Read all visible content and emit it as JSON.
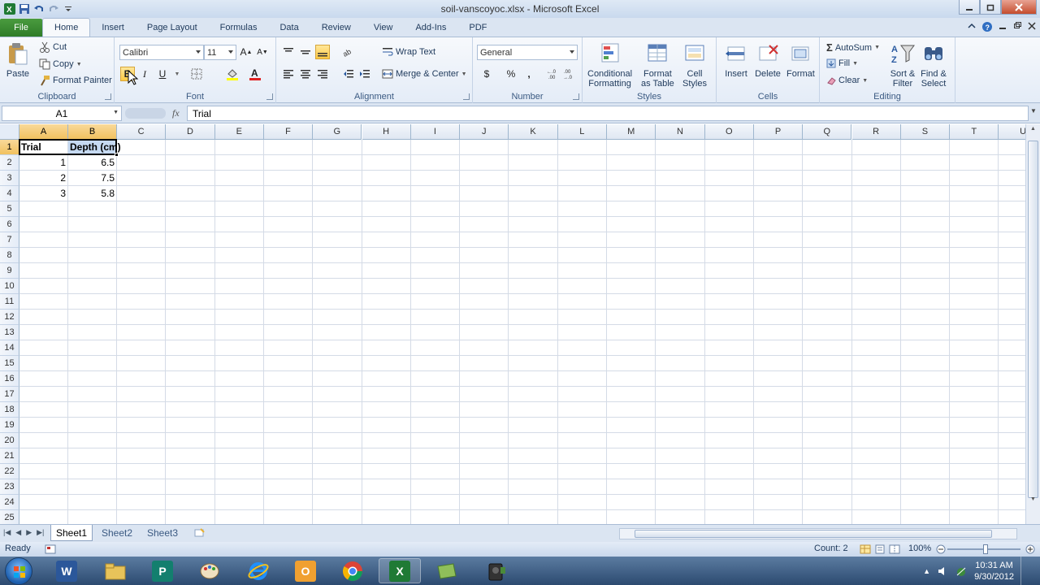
{
  "window": {
    "title": "soil-vanscoyoc.xlsx - Microsoft Excel"
  },
  "ribbon_tabs": {
    "file": "File",
    "tabs": [
      "Home",
      "Insert",
      "Page Layout",
      "Formulas",
      "Data",
      "Review",
      "View",
      "Add-Ins",
      "PDF"
    ],
    "active": "Home"
  },
  "clipboard": {
    "paste": "Paste",
    "cut": "Cut",
    "copy": "Copy",
    "format_painter": "Format Painter",
    "label": "Clipboard"
  },
  "font": {
    "name": "Calibri",
    "size": "11",
    "bold": "B",
    "italic": "I",
    "underline": "U",
    "label": "Font",
    "font_color": "#e02020",
    "fill_color": "#ffff00"
  },
  "alignment": {
    "wrap_text": "Wrap Text",
    "merge_center": "Merge & Center",
    "label": "Alignment"
  },
  "number": {
    "format": "General",
    "currency": "$",
    "percent": "%",
    "comma": ",",
    "label": "Number"
  },
  "styles": {
    "conditional": [
      "Conditional",
      "Formatting"
    ],
    "format_table": [
      "Format",
      "as Table"
    ],
    "cell_styles": [
      "Cell",
      "Styles"
    ],
    "label": "Styles"
  },
  "cells": {
    "insert": "Insert",
    "delete": "Delete",
    "format": "Format",
    "label": "Cells"
  },
  "editing": {
    "autosum": "AutoSum",
    "fill": "Fill",
    "clear": "Clear",
    "sort_filter": [
      "Sort &",
      "Filter"
    ],
    "find_select": [
      "Find &",
      "Select"
    ],
    "label": "Editing"
  },
  "formula_bar": {
    "name_box": "A1",
    "fx": "fx",
    "content": "Trial"
  },
  "grid": {
    "columns": [
      "A",
      "B",
      "C",
      "D",
      "E",
      "F",
      "G",
      "H",
      "I",
      "J",
      "K",
      "L",
      "M",
      "N",
      "O",
      "P",
      "Q",
      "R",
      "S",
      "T",
      "U"
    ],
    "rows": [
      "1",
      "2",
      "3",
      "4",
      "5",
      "6",
      "7",
      "8",
      "9",
      "10",
      "11",
      "12",
      "13",
      "14",
      "15",
      "16",
      "17",
      "18",
      "19",
      "20",
      "21",
      "22",
      "23",
      "24",
      "25"
    ],
    "data": [
      [
        "Trial",
        "Depth (cm)"
      ],
      [
        "1",
        "6.5"
      ],
      [
        "2",
        "7.5"
      ],
      [
        "3",
        "5.8"
      ]
    ]
  },
  "sheets": [
    "Sheet1",
    "Sheet2",
    "Sheet3"
  ],
  "status": {
    "ready": "Ready",
    "count": "Count: 2",
    "zoom": "100%"
  },
  "taskbar": {
    "time": "10:31 AM",
    "date": "9/30/2012"
  }
}
